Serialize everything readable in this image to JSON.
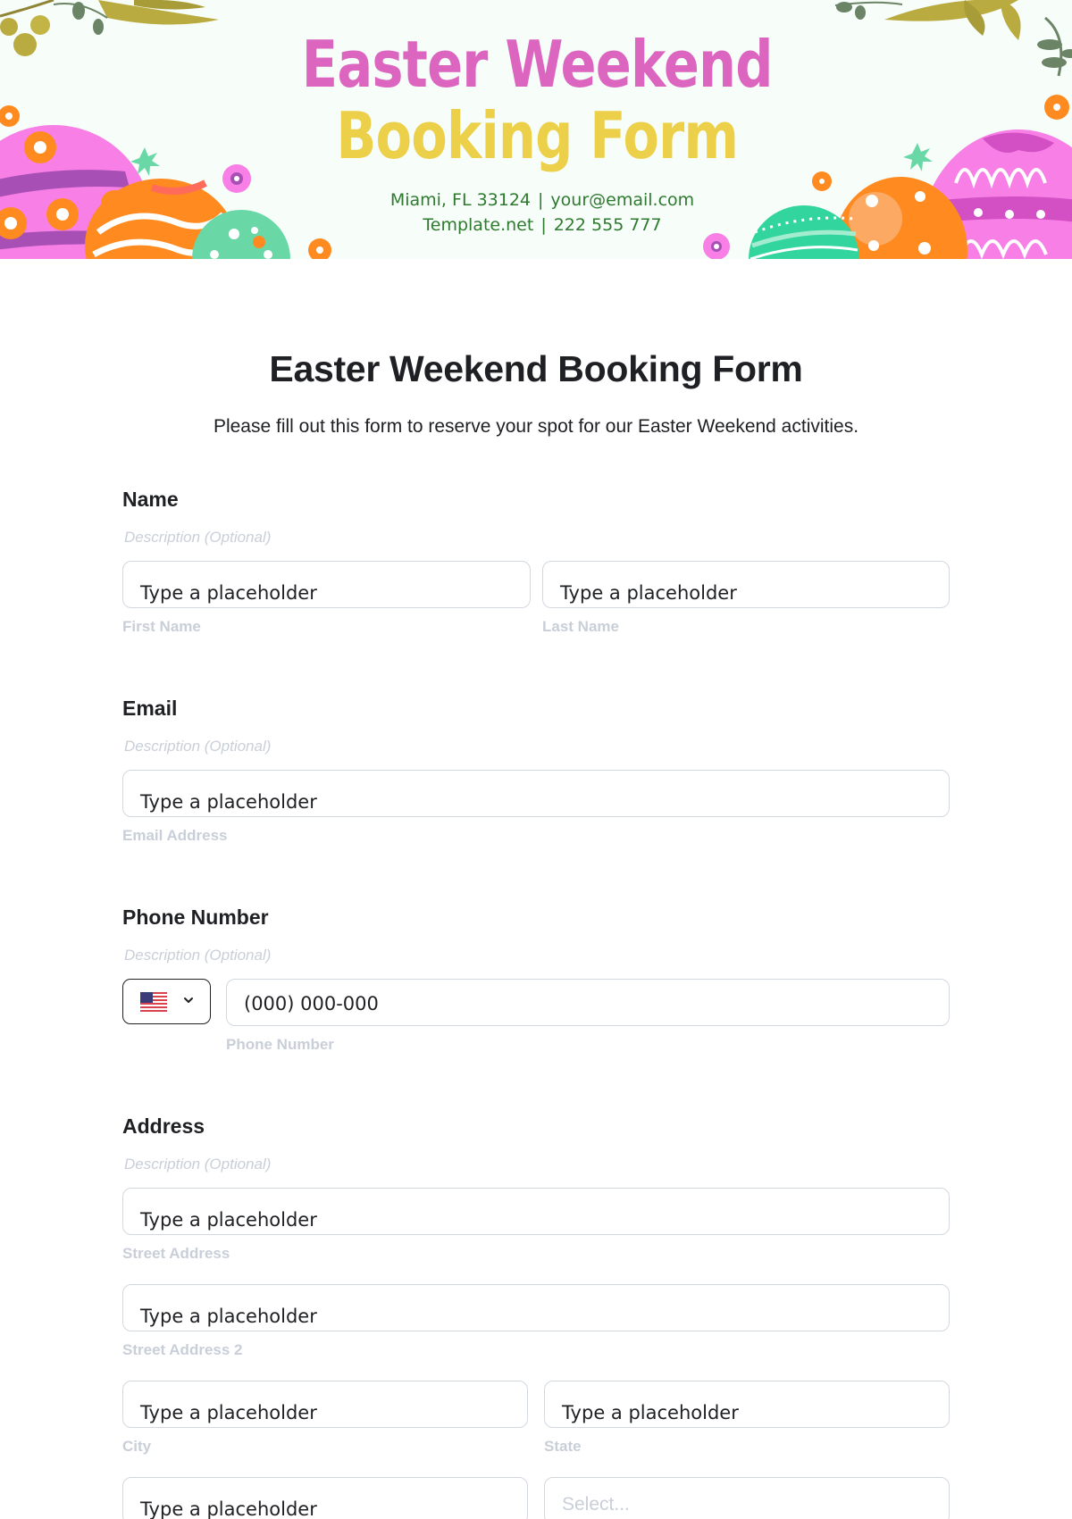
{
  "banner": {
    "title_line1": "Easter Weekend",
    "title_line2": "Booking Form",
    "contact_line1": [
      "Miami, FL 33124",
      "|",
      "your@email.com"
    ],
    "contact_line2": [
      "Template.net",
      "|",
      "222 555 777"
    ],
    "colors": {
      "pink": "#dc65bf",
      "yellow": "#ecd04a",
      "green_text": "#2e7a2e"
    }
  },
  "form": {
    "title": "Easter Weekend Booking Form",
    "subtitle": "Please fill out this form to reserve your spot for our Easter Weekend activities.",
    "sections": {
      "name": {
        "label": "Name",
        "description": "Description (Optional)",
        "first": {
          "placeholder": "Type a placeholder",
          "helper": "First Name"
        },
        "last": {
          "placeholder": "Type a placeholder",
          "helper": "Last Name"
        }
      },
      "email": {
        "label": "Email",
        "description": "Description (Optional)",
        "field": {
          "placeholder": "Type a placeholder",
          "helper": "Email Address"
        }
      },
      "phone": {
        "label": "Phone Number",
        "description": "Description (Optional)",
        "country": {
          "selected": "United States",
          "icon": "us-flag-icon"
        },
        "field": {
          "placeholder": "(000) 000-000",
          "helper": "Phone Number"
        }
      },
      "address": {
        "label": "Address",
        "description": "Description (Optional)",
        "street": {
          "placeholder": "Type a placeholder",
          "helper": "Street Address"
        },
        "street2": {
          "placeholder": "Type a placeholder",
          "helper": "Street Address 2"
        },
        "city": {
          "placeholder": "Type a placeholder",
          "helper": "City"
        },
        "state": {
          "placeholder": "Type a placeholder",
          "helper": "State"
        },
        "zip": {
          "placeholder": "Type a placeholder"
        },
        "country_select": {
          "placeholder": "Select..."
        }
      }
    }
  }
}
